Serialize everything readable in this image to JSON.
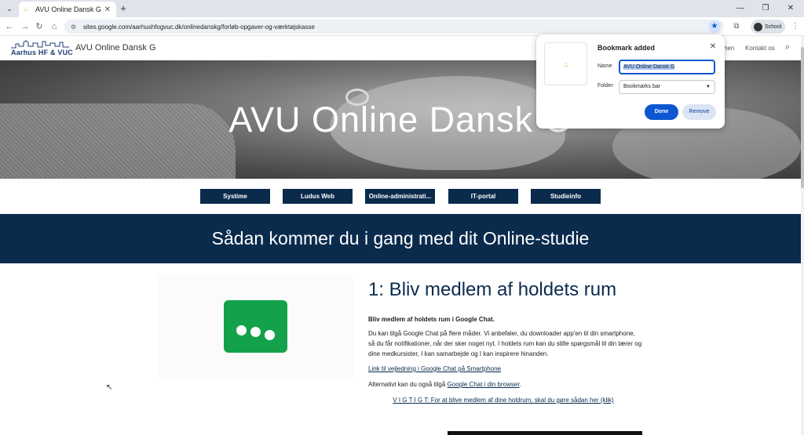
{
  "browser": {
    "tab_title": "AVU Online Dansk G",
    "tab_close": "✕",
    "new_tab": "+",
    "url": "sites.google.com/aarhushfogvuc.dk/onlinedanskg/forløb-opgaver-og-værktøjskasse",
    "profile_label": "School",
    "icons": {
      "tab_search": "⌄",
      "back": "←",
      "forward": "→",
      "reload": "↻",
      "home": "⌂",
      "site_info": "⚙",
      "star": "★",
      "extensions": "⧉",
      "menu": "⋮",
      "minimize": "—",
      "restore": "❐",
      "close": "✕"
    }
  },
  "site": {
    "logo_text": "Aarhus HF & VUC",
    "title": "AVU Online Dansk G",
    "nav_partial": "hen",
    "nav_contact": "Kontakt os",
    "search_icon": "⌕"
  },
  "hero": {
    "title": "AVU Online Dansk G"
  },
  "buttons": [
    "Systime",
    "Ludus Web",
    "Online-administrati...",
    "IT-portal",
    "Studieinfo"
  ],
  "banner": {
    "title": "Sådan kommer du i gang med dit Online-studie"
  },
  "section": {
    "title": "1: Bliv medlem af holdets rum",
    "subtitle": "Bliv medlem af holdets rum i Google Chat.",
    "body": "Du kan tilgå Google Chat på flere måder. Vi anbefaler, du downloader app'en til din smartphone, så du får notifikationer, når der sker noget nyt. I holdets rum kan du stille spørgsmål til din lærer og dine medkursister, I kan samarbejde og I kan inspirere hinanden.",
    "link_smartphone": "Link til vejledning i Google Chat på Smartphone",
    "alt_prefix": "Alternativt kan du også tilgå ",
    "alt_link": "Google Chat i din browser",
    "alt_suffix": ".",
    "important_link": "V I G T I G T: For at blive medlem af dine holdrum, skal du gøre sådan her (klik)"
  },
  "bookmark": {
    "title": "Bookmark added",
    "close": "✕",
    "name_label": "Name",
    "name_value": "AVU Online Dansk G",
    "folder_label": "Folder",
    "folder_value": "Bookmarks bar",
    "done": "Done",
    "remove": "Remove"
  },
  "colors": {
    "navy": "#0b2b4d",
    "chat_green": "#13a24b",
    "chrome_blue": "#0b57d0"
  }
}
